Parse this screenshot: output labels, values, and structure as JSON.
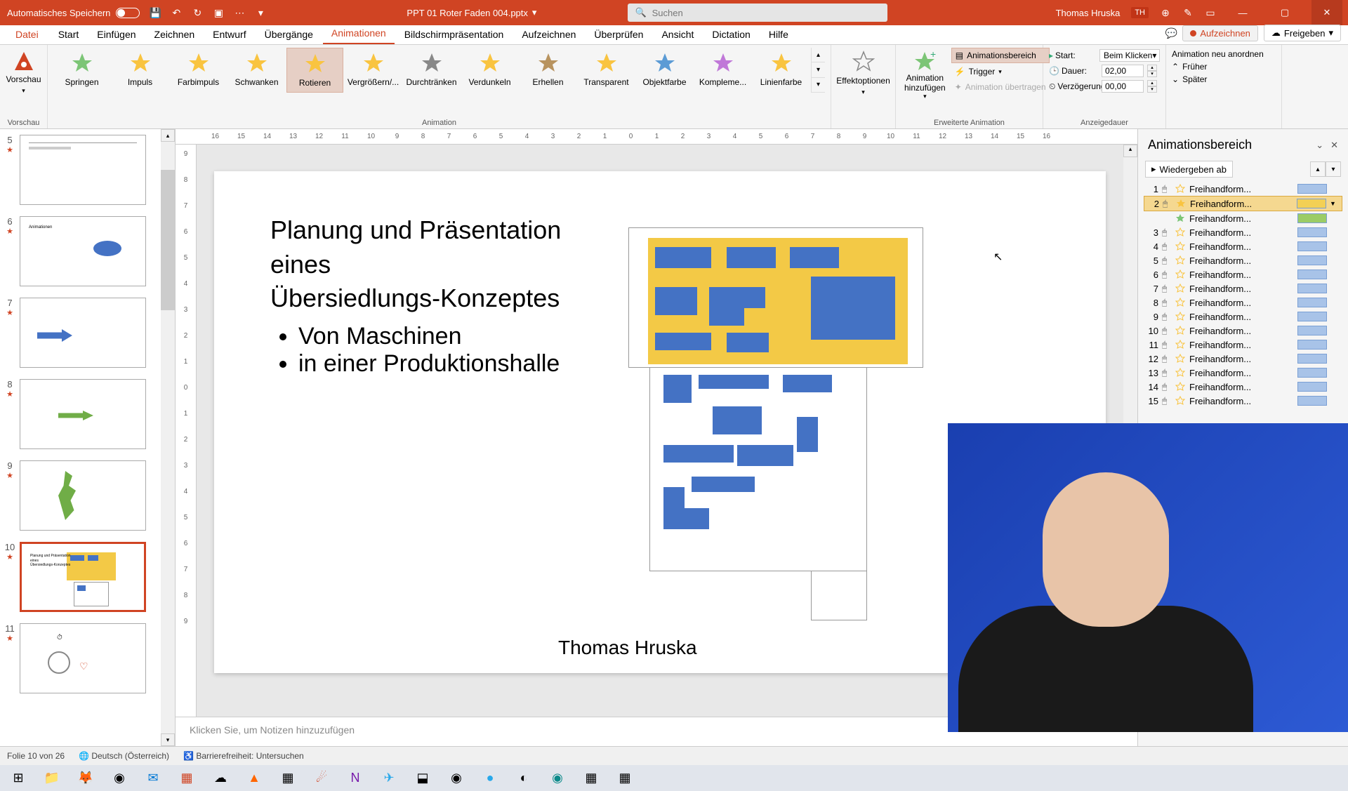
{
  "titlebar": {
    "autosave": "Automatisches Speichern",
    "filename": "PPT 01 Roter Faden 004.pptx",
    "search_placeholder": "Suchen",
    "username": "Thomas Hruska",
    "user_initials": "TH"
  },
  "menu": {
    "file": "Datei",
    "tabs": [
      "Start",
      "Einfügen",
      "Zeichnen",
      "Entwurf",
      "Übergänge",
      "Animationen",
      "Bildschirmpräsentation",
      "Aufzeichnen",
      "Überprüfen",
      "Ansicht",
      "Dictation",
      "Hilfe"
    ],
    "active": "Animationen",
    "record": "Aufzeichnen",
    "share": "Freigeben"
  },
  "ribbon": {
    "preview_label": "Vorschau",
    "preview_group": "Vorschau",
    "anims": [
      "Springen",
      "Impuls",
      "Farbimpuls",
      "Schwanken",
      "Rotieren",
      "Vergrößern/...",
      "Durchtränken",
      "Verdunkeln",
      "Erhellen",
      "Transparent",
      "Objektfarbe",
      "Kompleme...",
      "Linienfarbe"
    ],
    "anim_selected": "Rotieren",
    "anim_group": "Animation",
    "effect_options": "Effektoptionen",
    "add_anim": "Animation hinzufügen",
    "anim_pane_btn": "Animationsbereich",
    "trigger": "Trigger",
    "copy_anim": "Animation übertragen",
    "adv_group": "Erweiterte Animation",
    "start_label": "Start:",
    "start_value": "Beim Klicken",
    "duration_label": "Dauer:",
    "duration_value": "02,00",
    "delay_label": "Verzögerung:",
    "delay_value": "00,00",
    "timing_group": "Anzeigedauer",
    "reorder_title": "Animation neu anordnen",
    "earlier": "Früher",
    "later": "Später"
  },
  "thumbs": [
    {
      "num": "5"
    },
    {
      "num": "6"
    },
    {
      "num": "7"
    },
    {
      "num": "8"
    },
    {
      "num": "9"
    },
    {
      "num": "10",
      "active": true
    },
    {
      "num": "11"
    }
  ],
  "slide": {
    "title_l1": "Planung und Präsentation",
    "title_l2": "eines",
    "title_l3": "Übersiedlungs-Konzeptes",
    "bullet1": "Von Maschinen",
    "bullet2": "in einer Produktionshalle",
    "author": "Thomas Hruska"
  },
  "notes_placeholder": "Klicken Sie, um Notizen hinzuzufügen",
  "anim_pane": {
    "title": "Animationsbereich",
    "play": "Wiedergeben ab",
    "items": [
      {
        "n": "1",
        "name": "Freihandform...",
        "c": "#a8c3e8"
      },
      {
        "n": "2",
        "name": "Freihandform...",
        "c": "#f3d055",
        "sel": true
      },
      {
        "n": "",
        "name": "Freihandform...",
        "c": "#9bcc65"
      },
      {
        "n": "3",
        "name": "Freihandform...",
        "c": "#a8c3e8"
      },
      {
        "n": "4",
        "name": "Freihandform...",
        "c": "#a8c3e8"
      },
      {
        "n": "5",
        "name": "Freihandform...",
        "c": "#a8c3e8"
      },
      {
        "n": "6",
        "name": "Freihandform...",
        "c": "#a8c3e8"
      },
      {
        "n": "7",
        "name": "Freihandform...",
        "c": "#a8c3e8"
      },
      {
        "n": "8",
        "name": "Freihandform...",
        "c": "#a8c3e8"
      },
      {
        "n": "9",
        "name": "Freihandform...",
        "c": "#a8c3e8"
      },
      {
        "n": "10",
        "name": "Freihandform...",
        "c": "#a8c3e8"
      },
      {
        "n": "11",
        "name": "Freihandform...",
        "c": "#a8c3e8"
      },
      {
        "n": "12",
        "name": "Freihandform...",
        "c": "#a8c3e8"
      },
      {
        "n": "13",
        "name": "Freihandform...",
        "c": "#a8c3e8"
      },
      {
        "n": "14",
        "name": "Freihandform...",
        "c": "#a8c3e8"
      },
      {
        "n": "15",
        "name": "Freihandform...",
        "c": "#a8c3e8"
      }
    ]
  },
  "status": {
    "slide_info": "Folie 10 von 26",
    "lang": "Deutsch (Österreich)",
    "access": "Barrierefreiheit: Untersuchen"
  },
  "ruler_h": [
    "16",
    "15",
    "14",
    "13",
    "12",
    "11",
    "10",
    "9",
    "8",
    "7",
    "6",
    "5",
    "4",
    "3",
    "2",
    "1",
    "0",
    "1",
    "2",
    "3",
    "4",
    "5",
    "6",
    "7",
    "8",
    "9",
    "10",
    "11",
    "12",
    "13",
    "14",
    "15",
    "16"
  ],
  "ruler_v": [
    "9",
    "8",
    "7",
    "6",
    "5",
    "4",
    "3",
    "2",
    "1",
    "0",
    "1",
    "2",
    "3",
    "4",
    "5",
    "6",
    "7",
    "8",
    "9"
  ],
  "star_colors": [
    "#7cc576",
    "#f9c440",
    "#f9c440",
    "#f9c440",
    "#f9c440",
    "#f9c440",
    "#888",
    "#f9c440",
    "#b8935f",
    "#f9c440",
    "#5b9bd5",
    "#c078d8",
    "#f9c440"
  ]
}
